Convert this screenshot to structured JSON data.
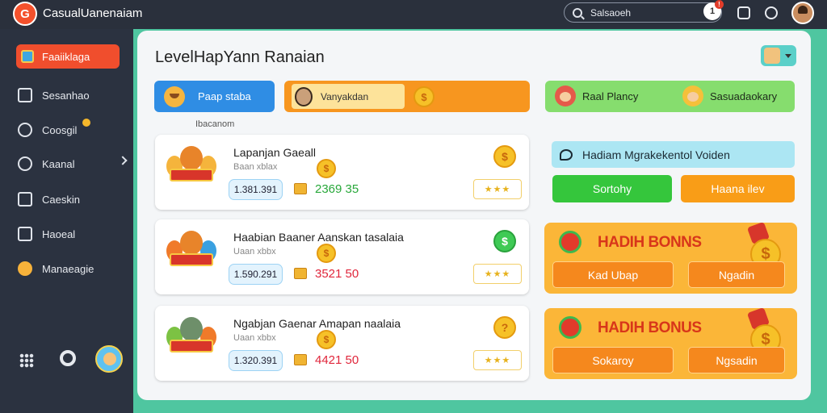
{
  "app": {
    "logo": "G",
    "title": "CasualUanenaiam"
  },
  "topbar": {
    "search_text": "Salsaoeh",
    "notif_count": "1",
    "notif_badge": "!"
  },
  "sidebar": {
    "items": [
      {
        "label": "Faaiiklaga",
        "icon": "game-icon",
        "active": true
      },
      {
        "label": "Sesanhao",
        "icon": "book-icon"
      },
      {
        "label": "Coosgil",
        "icon": "coins-icon"
      },
      {
        "label": "Kaanal",
        "icon": "globe-icon"
      },
      {
        "label": "Caeskin",
        "icon": "edit-icon"
      },
      {
        "label": "Haoeal",
        "icon": "document-icon"
      },
      {
        "label": "Manaeagie",
        "icon": "coin-icon"
      }
    ]
  },
  "main": {
    "title": "LevelHapYann Ranaian",
    "top_buttons": {
      "blue": "Paap staba",
      "orange_label": "Vanyakdan",
      "orange_coin": "$",
      "green_left": "Raal Plancy",
      "green_right": "Sasuadaokary"
    },
    "section_label": "Ibacanom",
    "cards": [
      {
        "name": "Lapanjan   Gaeall",
        "sub": "Baan xblax",
        "value": "1.381.391",
        "amount": "2369 35",
        "amount_color": "#28a83a",
        "coin_mid": "$",
        "coin_right": "$",
        "coin_right_color": "orange",
        "stars": "★★★"
      },
      {
        "name": "Haabian    Baaner Aanskan tasalaia",
        "sub": "Uaan xbbx",
        "value": "1.590.291",
        "amount": "3521 50",
        "amount_color": "#e0263b",
        "coin_mid": "$",
        "coin_right": "$",
        "coin_right_color": "green",
        "stars": "★★★"
      },
      {
        "name": "Ngabjan    Gaenar Amapan naalaia",
        "sub": "Uaan xbbx",
        "value": "1.320.391",
        "amount": "4421 50",
        "amount_color": "#e0263b",
        "coin_mid": "$",
        "coin_right": "?",
        "coin_right_color": "orange",
        "stars": "★★★"
      }
    ],
    "right": {
      "notice": "Hadiam Mgrakekentol Voiden",
      "btn_green": "Sortohy",
      "btn_orange": "Haana ilev",
      "bonus1": {
        "title": "HADIH BONNS",
        "btn1": "Kad Ubap",
        "btn2": "Ngadin",
        "coin": "$"
      },
      "bonus2": {
        "title": "HADIH BONUS",
        "btn1": "Sokaroy",
        "btn2": "Ngsadin",
        "coin": "$"
      }
    }
  }
}
